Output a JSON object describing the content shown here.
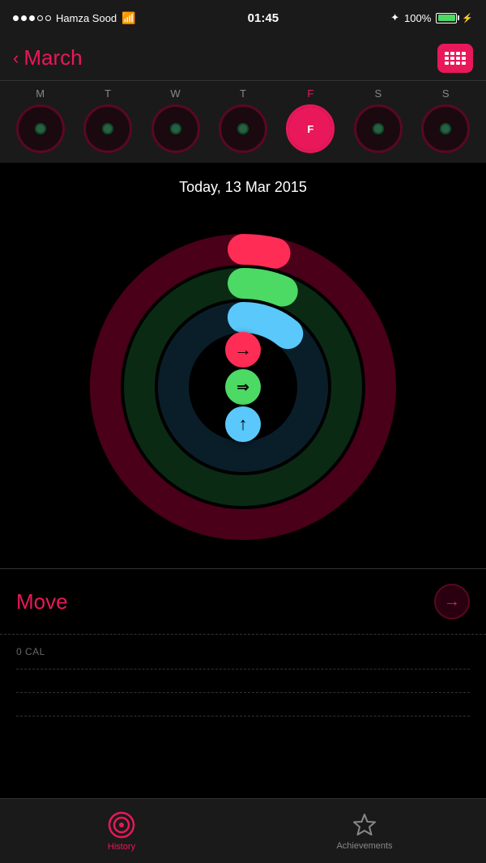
{
  "status_bar": {
    "carrier": "Hamza Sood",
    "time": "01:45",
    "battery": "100%"
  },
  "nav": {
    "back_label": "March",
    "title": "March"
  },
  "week": {
    "days": [
      "M",
      "T",
      "W",
      "T",
      "F",
      "S",
      "S"
    ],
    "active_index": 4
  },
  "main": {
    "date_label": "Today, 13 Mar 2015",
    "rings": {
      "outer_color": "#8b0a28",
      "middle_color": "#1a5c2a",
      "inner_color": "#1a4a5c",
      "outer_progress": 15,
      "middle_progress": 20,
      "inner_progress": 30
    },
    "arrows": [
      {
        "color": "red",
        "symbol": "→"
      },
      {
        "color": "green",
        "symbol": "⇒"
      },
      {
        "color": "cyan",
        "symbol": "↑"
      }
    ]
  },
  "move_section": {
    "label": "Move",
    "arrow": "→"
  },
  "stats": [
    {
      "value": "0 CAL"
    },
    {
      "value": ""
    },
    {
      "value": ""
    }
  ],
  "tab_bar": {
    "items": [
      {
        "id": "history",
        "label": "History",
        "active": true
      },
      {
        "id": "achievements",
        "label": "Achievements",
        "active": false
      }
    ]
  }
}
